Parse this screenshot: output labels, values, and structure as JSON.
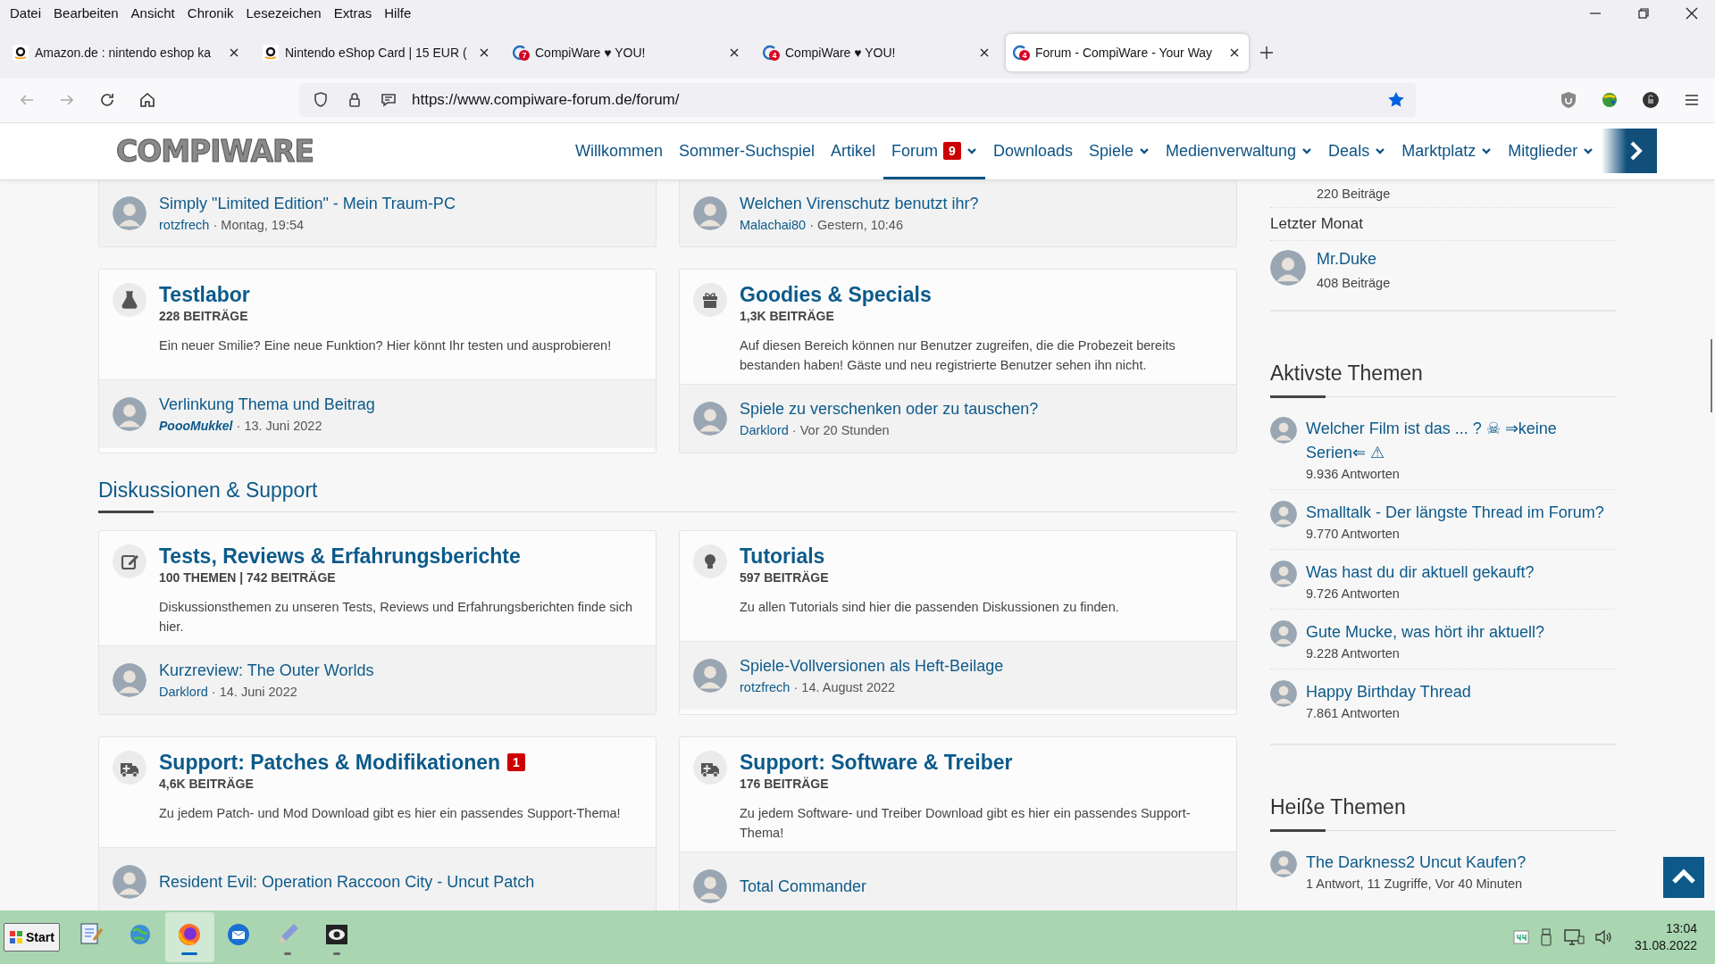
{
  "menu": [
    "Datei",
    "Bearbeiten",
    "Ansicht",
    "Chronik",
    "Lesezeichen",
    "Extras",
    "Hilfe"
  ],
  "tabs": [
    {
      "title": "Amazon.de : nintendo eshop ka",
      "kind": "amazon",
      "selected": false
    },
    {
      "title": "Nintendo eShop Card | 15 EUR (",
      "kind": "amazon",
      "selected": false
    },
    {
      "title": "CompiWare ♥ YOU!",
      "kind": "compiware",
      "count": "7",
      "selected": false
    },
    {
      "title": "CompiWare ♥ YOU!",
      "kind": "compiware",
      "count": "4",
      "selected": false
    },
    {
      "title": "Forum - CompiWare - Your Way",
      "kind": "compiware",
      "count": "4",
      "selected": true
    }
  ],
  "address_bar": {
    "url": "https://www.compiware-forum.de/forum/",
    "bookmarked": true
  },
  "site": {
    "logo": "COMPIWARE",
    "nav": [
      {
        "label": "Willkommen",
        "selected": false,
        "dropdown": false
      },
      {
        "label": "Sommer-Suchspiel",
        "selected": false,
        "dropdown": false
      },
      {
        "label": "Artikel",
        "selected": false,
        "dropdown": false
      },
      {
        "label": "Forum",
        "badge": "9",
        "selected": true,
        "dropdown": true
      },
      {
        "label": "Downloads",
        "selected": false,
        "dropdown": false
      },
      {
        "label": "Spiele",
        "selected": false,
        "dropdown": true
      },
      {
        "label": "Medienverwaltung",
        "selected": false,
        "dropdown": true
      },
      {
        "label": "Deals",
        "selected": false,
        "dropdown": true
      },
      {
        "label": "Marktplatz",
        "selected": false,
        "dropdown": true
      },
      {
        "label": "Mitglieder",
        "selected": false,
        "dropdown": true
      }
    ]
  },
  "forum": {
    "top_latest": [
      {
        "title": "Simply \"Limited Edition\" - Mein Traum-PC",
        "author": "rotzfrech",
        "separator": "·",
        "date": "Montag, 19:54"
      },
      {
        "title": "Welchen Virenschutz benutzt ihr?",
        "author": "Malachai80",
        "separator": "·",
        "date": "Gestern, 10:46"
      }
    ],
    "nodes": [
      {
        "kind": "flask",
        "title": "Testlabor",
        "stats": "228 BEITRÄGE",
        "description": "Ein neuer Smilie? Eine neue Funktion? Hier könnt Ihr testen und ausprobieren!",
        "last_post": {
          "title": "Verlinkung Thema und Beitrag",
          "author": "PoooMukkel",
          "author_styled": true,
          "separator": "·",
          "date": "13. Juni 2022"
        }
      },
      {
        "kind": "gift",
        "title": "Goodies & Specials",
        "stats": "1,3K BEITRÄGE",
        "description": "Auf diesen Bereich können nur Benutzer zugreifen, die die Probezeit bereits bestanden haben! Gäste und neu registrierte Benutzer sehen ihn nicht.",
        "last_post": {
          "title": "Spiele zu verschenken oder zu tauschen?",
          "author": "Darklord",
          "author_styled": false,
          "separator": "·",
          "date": "Vor 20 Stunden"
        }
      }
    ],
    "sections": [
      {
        "title": "Diskussionen & Support",
        "nodes": [
          {
            "kind": "edit",
            "title": "Tests, Reviews & Erfahrungsberichte",
            "stats": "100 THEMEN | 742 BEITRÄGE",
            "description": "Diskussionsthemen zu unseren Tests, Reviews und Erfahrungsberichten finde sich hier.",
            "last_post": {
              "title": "Kurzreview: The Outer Worlds",
              "author": "Darklord",
              "author_styled": false,
              "separator": "·",
              "date": "14. Juni 2022"
            }
          },
          {
            "kind": "bulb",
            "title": "Tutorials",
            "stats": "597 BEITRÄGE",
            "description": "Zu allen Tutorials sind hier die passenden Diskussionen zu finden.",
            "last_post": {
              "title": "Spiele-Vollversionen als Heft-Beilage",
              "author": "rotzfrech",
              "author_styled": false,
              "separator": "·",
              "date": "14. August 2022"
            }
          },
          {
            "kind": "ambulance",
            "title": "Support: Patches & Modifikationen",
            "badge": "1",
            "stats": "4,6K BEITRÄGE",
            "description": "Zu jedem Patch- und Mod Download gibt es hier ein passendes Support-Thema!",
            "last_post": {
              "title": "Resident Evil: Operation Raccoon City - Uncut Patch"
            }
          },
          {
            "kind": "ambulance",
            "title": "Support: Software & Treiber",
            "stats": "176 BEITRÄGE",
            "description": "Zu jedem Software- und Treiber Download gibt es hier ein passendes Support-Thema!",
            "last_post": {
              "title": "Total Commander"
            }
          }
        ]
      }
    ]
  },
  "sidebar": {
    "top_count": "220 Beiträge",
    "period": "Letzter Monat",
    "top_poster": {
      "name": "Mr.Duke",
      "count": "408 Beiträge"
    },
    "active_topics": {
      "title": "Aktivste Themen",
      "items": [
        {
          "title": "Welcher Film ist das ... ? ☠ ⇒keine Serien⇐ ⚠",
          "info": "9.936 Antworten"
        },
        {
          "title": "Smalltalk - Der längste Thread im Forum?",
          "info": "9.770 Antworten"
        },
        {
          "title": "Was hast du dir aktuell gekauft?",
          "info": "9.726 Antworten"
        },
        {
          "title": "Gute Mucke, was hört ihr aktuell?",
          "info": "9.228 Antworten"
        },
        {
          "title": "Happy Birthday Thread",
          "info": "7.861 Antworten"
        }
      ]
    },
    "hot_topics": {
      "title": "Heiße Themen",
      "items": [
        {
          "title": "The Darkness2 Uncut Kaufen?",
          "info": "1 Antwort, 11 Zugriffe, Vor 40 Minuten"
        }
      ]
    }
  },
  "taskbar": {
    "start": "Start",
    "apps": [
      {
        "kind": "notepad",
        "active": false,
        "running": false
      },
      {
        "kind": "globe",
        "active": false,
        "running": false
      },
      {
        "kind": "firefox",
        "active": true,
        "running": true
      },
      {
        "kind": "thunderbird",
        "active": false,
        "running": false
      },
      {
        "kind": "pen",
        "active": false,
        "running": true
      },
      {
        "kind": "eye",
        "active": false,
        "running": true
      }
    ],
    "clock": {
      "time": "13:04",
      "date": "31.08.2022"
    }
  }
}
